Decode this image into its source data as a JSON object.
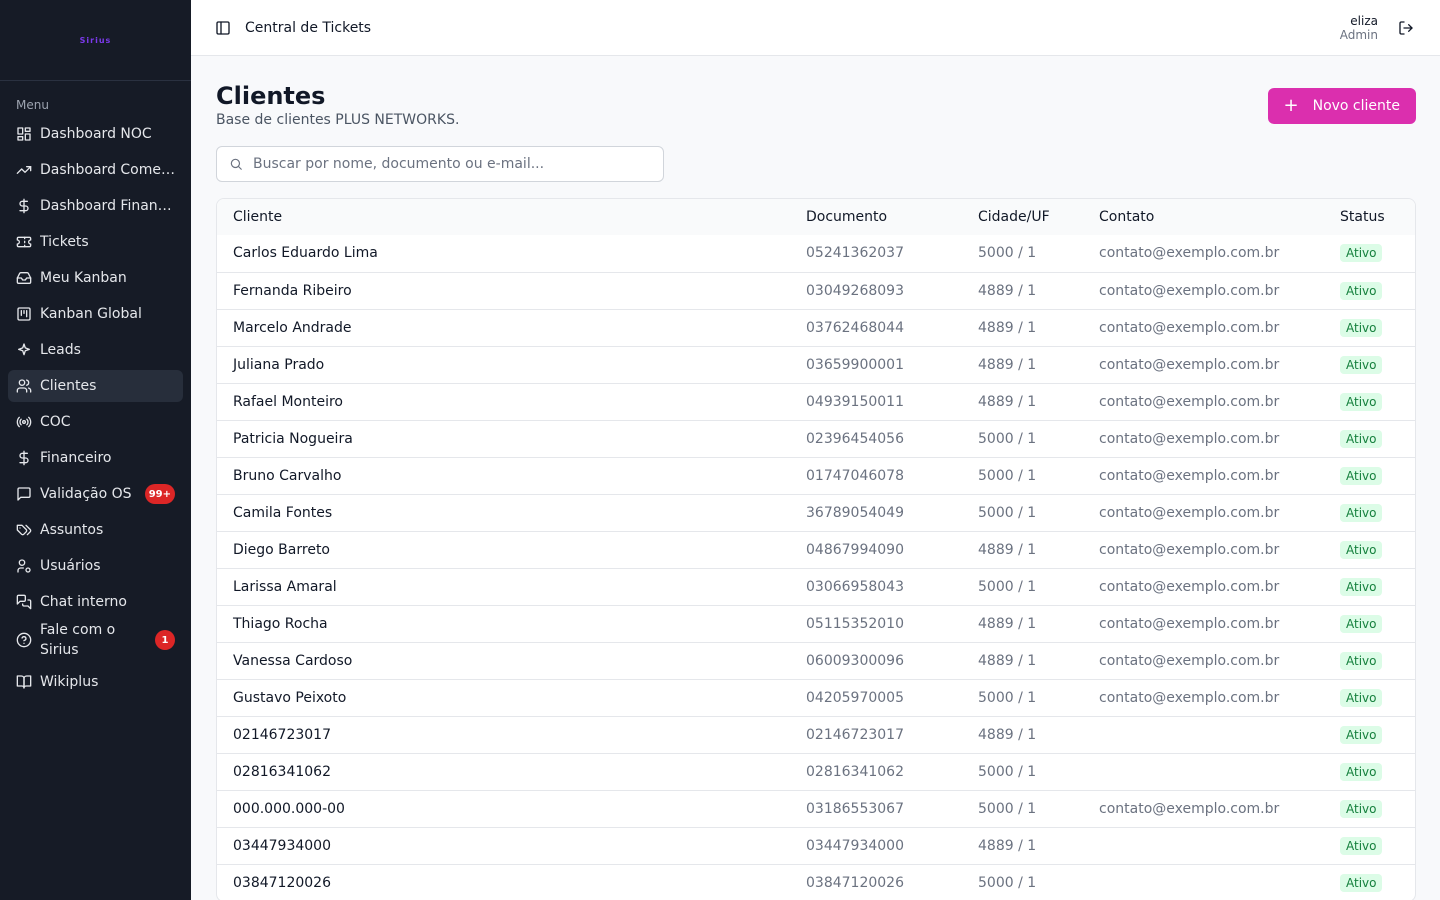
{
  "sidebar": {
    "logo_text": "Sirius",
    "menu_label": "Menu",
    "items": [
      {
        "label": "Dashboard NOC",
        "icon": "dashboard-icon"
      },
      {
        "label": "Dashboard Comercial",
        "icon": "trending-up-icon"
      },
      {
        "label": "Dashboard Financeiro",
        "icon": "dollar-icon"
      },
      {
        "label": "Tickets",
        "icon": "ticket-icon"
      },
      {
        "label": "Meu Kanban",
        "icon": "inbox-icon"
      },
      {
        "label": "Kanban Global",
        "icon": "kanban-icon"
      },
      {
        "label": "Leads",
        "icon": "sparkles-icon"
      },
      {
        "label": "Clientes",
        "icon": "users-icon"
      },
      {
        "label": "COC",
        "icon": "radio-icon"
      },
      {
        "label": "Financeiro",
        "icon": "dollar-icon"
      },
      {
        "label": "Validação OS",
        "icon": "message-icon",
        "badge": "99+"
      },
      {
        "label": "Assuntos",
        "icon": "tags-icon"
      },
      {
        "label": "Usuários",
        "icon": "user-cog-icon"
      },
      {
        "label": "Chat interno",
        "icon": "chat-icon"
      },
      {
        "label": "Fale com o Sirius",
        "icon": "help-circle-icon",
        "badge": "1"
      },
      {
        "label": "Wikiplus",
        "icon": "book-icon"
      }
    ]
  },
  "header": {
    "title": "Central de Tickets",
    "user_name": "eliza",
    "user_role": "Admin"
  },
  "page": {
    "title": "Clientes",
    "subtitle": "Base de clientes PLUS NETWORKS.",
    "new_button": "Novo cliente",
    "search_placeholder": "Buscar por nome, documento ou e-mail..."
  },
  "table": {
    "headers": [
      "Cliente",
      "Documento",
      "Cidade/UF",
      "Contato",
      "Status"
    ],
    "rows": [
      [
        "Carlos Eduardo Lima",
        "05241362037",
        "5000 / 1",
        "contato@exemplo.com.br",
        "Ativo"
      ],
      [
        "Fernanda Ribeiro",
        "03049268093",
        "4889 / 1",
        "contato@exemplo.com.br",
        "Ativo"
      ],
      [
        "Marcelo Andrade",
        "03762468044",
        "4889 / 1",
        "contato@exemplo.com.br",
        "Ativo"
      ],
      [
        "Juliana Prado",
        "03659900001",
        "4889 / 1",
        "contato@exemplo.com.br",
        "Ativo"
      ],
      [
        "Rafael Monteiro",
        "04939150011",
        "4889 / 1",
        "contato@exemplo.com.br",
        "Ativo"
      ],
      [
        "Patricia Nogueira",
        "02396454056",
        "5000 / 1",
        "contato@exemplo.com.br",
        "Ativo"
      ],
      [
        "Bruno Carvalho",
        "01747046078",
        "5000 / 1",
        "contato@exemplo.com.br",
        "Ativo"
      ],
      [
        "Camila Fontes",
        "36789054049",
        "5000 / 1",
        "contato@exemplo.com.br",
        "Ativo"
      ],
      [
        "Diego Barreto",
        "04867994090",
        "4889 / 1",
        "contato@exemplo.com.br",
        "Ativo"
      ],
      [
        "Larissa Amaral",
        "03066958043",
        "5000 / 1",
        "contato@exemplo.com.br",
        "Ativo"
      ],
      [
        "Thiago Rocha",
        "05115352010",
        "4889 / 1",
        "contato@exemplo.com.br",
        "Ativo"
      ],
      [
        "Vanessa Cardoso",
        "06009300096",
        "4889 / 1",
        "contato@exemplo.com.br",
        "Ativo"
      ],
      [
        "Gustavo Peixoto",
        "04205970005",
        "5000 / 1",
        "contato@exemplo.com.br",
        "Ativo"
      ],
      [
        "02146723017",
        "02146723017",
        "4889 / 1",
        "",
        "Ativo"
      ],
      [
        "02816341062",
        "02816341062",
        "5000 / 1",
        "",
        "Ativo"
      ],
      [
        "000.000.000-00",
        "03186553067",
        "5000 / 1",
        "contato@exemplo.com.br",
        "Ativo"
      ],
      [
        "03447934000",
        "03447934000",
        "4889 / 1",
        "",
        "Ativo"
      ],
      [
        "03847120026",
        "03847120026",
        "5000 / 1",
        "",
        "Ativo"
      ]
    ]
  },
  "colors": {
    "sidebar_bg": "#161b26",
    "accent": "#db2fae",
    "status_text": "#15803d",
    "status_bg": "#dcfce7",
    "badge": "#dc2626"
  }
}
